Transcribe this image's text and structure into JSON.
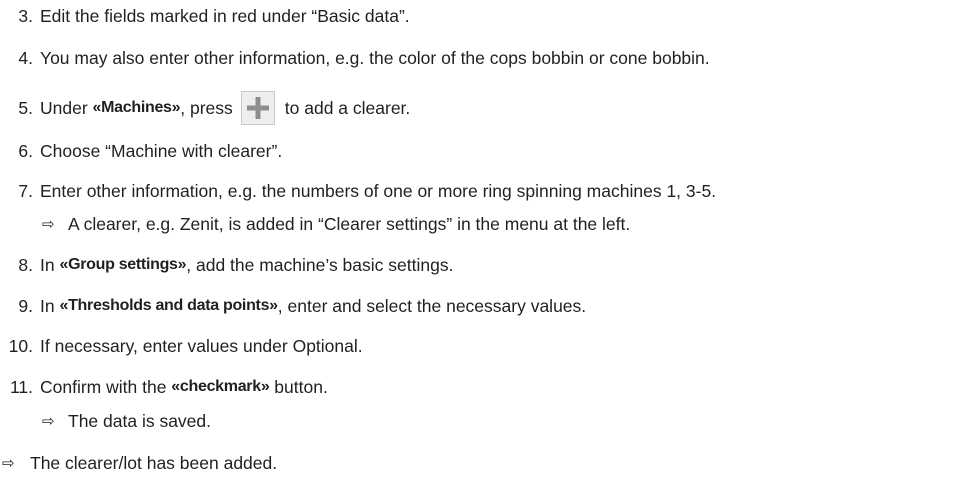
{
  "steps": [
    {
      "num": "3.",
      "text": "Edit the fields marked in red under “Basic data”."
    },
    {
      "num": "4.",
      "text": "You may also enter other information, e.g. the color of the cops bobbin or cone bobbin."
    },
    {
      "num": "5.",
      "pre": "Under ",
      "bold": "«Machines»",
      "mid": ", press",
      "post": "to add a clearer."
    },
    {
      "num": "6.",
      "text": "Choose “Machine with clearer”."
    },
    {
      "num": "7.",
      "text": "Enter other information, e.g. the numbers of one or more ring spinning machines 1, 3-5."
    },
    {
      "result": "A clearer, e.g. Zenit, is added in “Clearer settings” in the menu at the left."
    },
    {
      "num": "8.",
      "pre": "In ",
      "bold": "«Group settings»",
      "post": ", add the machine’s basic settings."
    },
    {
      "num": "9.",
      "pre": "In ",
      "bold": "«Thresholds and data points»",
      "post": ", enter and select the necessary values."
    },
    {
      "num": "10.",
      "text": "If necessary, enter values under Optional."
    },
    {
      "num": "11.",
      "pre": "Confirm with the ",
      "bold": "«checkmark»",
      "post": " button."
    },
    {
      "result": "The data is saved."
    }
  ],
  "final_result": "The clearer/lot has been added.",
  "result_arrow": "⇨",
  "icons": {
    "add_button": "plus-icon"
  },
  "colors": {
    "text": "#231f20",
    "plus": "#8e8e8e",
    "button_bg": "#eeeeee"
  }
}
